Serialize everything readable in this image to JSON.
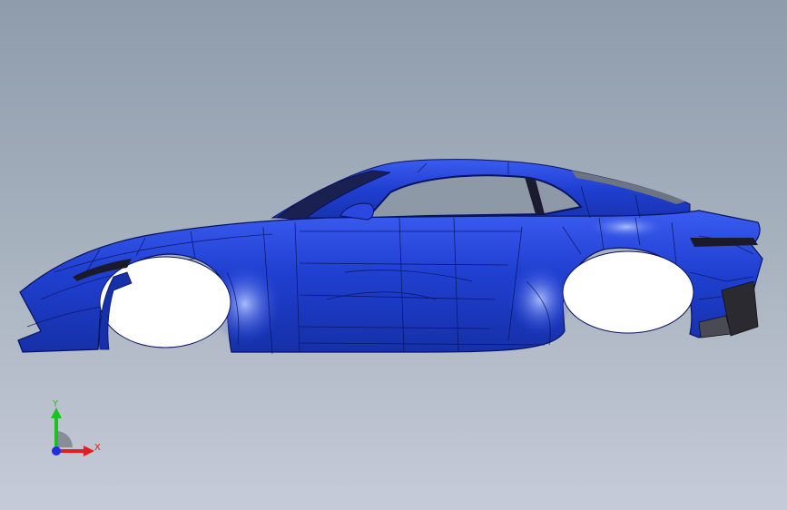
{
  "viewport": {
    "background_top": "#8e9cac",
    "background_bottom": "#c6cbd8"
  },
  "model": {
    "body_color": "#1f3fd0",
    "edge_color": "#0a1260",
    "wheel_arch_color": "#ffffff",
    "glass_color": "#9aa3b0"
  },
  "triad": {
    "x_label": "X",
    "y_label": "Y",
    "x_color": "#e02020",
    "y_color": "#20c020",
    "z_color": "#2030e0"
  }
}
